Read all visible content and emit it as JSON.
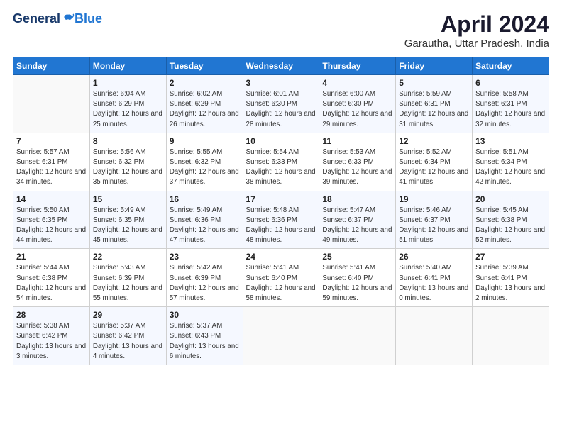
{
  "logo": {
    "general": "General",
    "blue": "Blue"
  },
  "title": "April 2024",
  "subtitle": "Garautha, Uttar Pradesh, India",
  "days_header": [
    "Sunday",
    "Monday",
    "Tuesday",
    "Wednesday",
    "Thursday",
    "Friday",
    "Saturday"
  ],
  "weeks": [
    [
      {
        "day": "",
        "sunrise": "",
        "sunset": "",
        "daylight": ""
      },
      {
        "day": "1",
        "sunrise": "Sunrise: 6:04 AM",
        "sunset": "Sunset: 6:29 PM",
        "daylight": "Daylight: 12 hours and 25 minutes."
      },
      {
        "day": "2",
        "sunrise": "Sunrise: 6:02 AM",
        "sunset": "Sunset: 6:29 PM",
        "daylight": "Daylight: 12 hours and 26 minutes."
      },
      {
        "day": "3",
        "sunrise": "Sunrise: 6:01 AM",
        "sunset": "Sunset: 6:30 PM",
        "daylight": "Daylight: 12 hours and 28 minutes."
      },
      {
        "day": "4",
        "sunrise": "Sunrise: 6:00 AM",
        "sunset": "Sunset: 6:30 PM",
        "daylight": "Daylight: 12 hours and 29 minutes."
      },
      {
        "day": "5",
        "sunrise": "Sunrise: 5:59 AM",
        "sunset": "Sunset: 6:31 PM",
        "daylight": "Daylight: 12 hours and 31 minutes."
      },
      {
        "day": "6",
        "sunrise": "Sunrise: 5:58 AM",
        "sunset": "Sunset: 6:31 PM",
        "daylight": "Daylight: 12 hours and 32 minutes."
      }
    ],
    [
      {
        "day": "7",
        "sunrise": "Sunrise: 5:57 AM",
        "sunset": "Sunset: 6:31 PM",
        "daylight": "Daylight: 12 hours and 34 minutes."
      },
      {
        "day": "8",
        "sunrise": "Sunrise: 5:56 AM",
        "sunset": "Sunset: 6:32 PM",
        "daylight": "Daylight: 12 hours and 35 minutes."
      },
      {
        "day": "9",
        "sunrise": "Sunrise: 5:55 AM",
        "sunset": "Sunset: 6:32 PM",
        "daylight": "Daylight: 12 hours and 37 minutes."
      },
      {
        "day": "10",
        "sunrise": "Sunrise: 5:54 AM",
        "sunset": "Sunset: 6:33 PM",
        "daylight": "Daylight: 12 hours and 38 minutes."
      },
      {
        "day": "11",
        "sunrise": "Sunrise: 5:53 AM",
        "sunset": "Sunset: 6:33 PM",
        "daylight": "Daylight: 12 hours and 39 minutes."
      },
      {
        "day": "12",
        "sunrise": "Sunrise: 5:52 AM",
        "sunset": "Sunset: 6:34 PM",
        "daylight": "Daylight: 12 hours and 41 minutes."
      },
      {
        "day": "13",
        "sunrise": "Sunrise: 5:51 AM",
        "sunset": "Sunset: 6:34 PM",
        "daylight": "Daylight: 12 hours and 42 minutes."
      }
    ],
    [
      {
        "day": "14",
        "sunrise": "Sunrise: 5:50 AM",
        "sunset": "Sunset: 6:35 PM",
        "daylight": "Daylight: 12 hours and 44 minutes."
      },
      {
        "day": "15",
        "sunrise": "Sunrise: 5:49 AM",
        "sunset": "Sunset: 6:35 PM",
        "daylight": "Daylight: 12 hours and 45 minutes."
      },
      {
        "day": "16",
        "sunrise": "Sunrise: 5:49 AM",
        "sunset": "Sunset: 6:36 PM",
        "daylight": "Daylight: 12 hours and 47 minutes."
      },
      {
        "day": "17",
        "sunrise": "Sunrise: 5:48 AM",
        "sunset": "Sunset: 6:36 PM",
        "daylight": "Daylight: 12 hours and 48 minutes."
      },
      {
        "day": "18",
        "sunrise": "Sunrise: 5:47 AM",
        "sunset": "Sunset: 6:37 PM",
        "daylight": "Daylight: 12 hours and 49 minutes."
      },
      {
        "day": "19",
        "sunrise": "Sunrise: 5:46 AM",
        "sunset": "Sunset: 6:37 PM",
        "daylight": "Daylight: 12 hours and 51 minutes."
      },
      {
        "day": "20",
        "sunrise": "Sunrise: 5:45 AM",
        "sunset": "Sunset: 6:38 PM",
        "daylight": "Daylight: 12 hours and 52 minutes."
      }
    ],
    [
      {
        "day": "21",
        "sunrise": "Sunrise: 5:44 AM",
        "sunset": "Sunset: 6:38 PM",
        "daylight": "Daylight: 12 hours and 54 minutes."
      },
      {
        "day": "22",
        "sunrise": "Sunrise: 5:43 AM",
        "sunset": "Sunset: 6:39 PM",
        "daylight": "Daylight: 12 hours and 55 minutes."
      },
      {
        "day": "23",
        "sunrise": "Sunrise: 5:42 AM",
        "sunset": "Sunset: 6:39 PM",
        "daylight": "Daylight: 12 hours and 57 minutes."
      },
      {
        "day": "24",
        "sunrise": "Sunrise: 5:41 AM",
        "sunset": "Sunset: 6:40 PM",
        "daylight": "Daylight: 12 hours and 58 minutes."
      },
      {
        "day": "25",
        "sunrise": "Sunrise: 5:41 AM",
        "sunset": "Sunset: 6:40 PM",
        "daylight": "Daylight: 12 hours and 59 minutes."
      },
      {
        "day": "26",
        "sunrise": "Sunrise: 5:40 AM",
        "sunset": "Sunset: 6:41 PM",
        "daylight": "Daylight: 13 hours and 0 minutes."
      },
      {
        "day": "27",
        "sunrise": "Sunrise: 5:39 AM",
        "sunset": "Sunset: 6:41 PM",
        "daylight": "Daylight: 13 hours and 2 minutes."
      }
    ],
    [
      {
        "day": "28",
        "sunrise": "Sunrise: 5:38 AM",
        "sunset": "Sunset: 6:42 PM",
        "daylight": "Daylight: 13 hours and 3 minutes."
      },
      {
        "day": "29",
        "sunrise": "Sunrise: 5:37 AM",
        "sunset": "Sunset: 6:42 PM",
        "daylight": "Daylight: 13 hours and 4 minutes."
      },
      {
        "day": "30",
        "sunrise": "Sunrise: 5:37 AM",
        "sunset": "Sunset: 6:43 PM",
        "daylight": "Daylight: 13 hours and 6 minutes."
      },
      {
        "day": "",
        "sunrise": "",
        "sunset": "",
        "daylight": ""
      },
      {
        "day": "",
        "sunrise": "",
        "sunset": "",
        "daylight": ""
      },
      {
        "day": "",
        "sunrise": "",
        "sunset": "",
        "daylight": ""
      },
      {
        "day": "",
        "sunrise": "",
        "sunset": "",
        "daylight": ""
      }
    ]
  ]
}
